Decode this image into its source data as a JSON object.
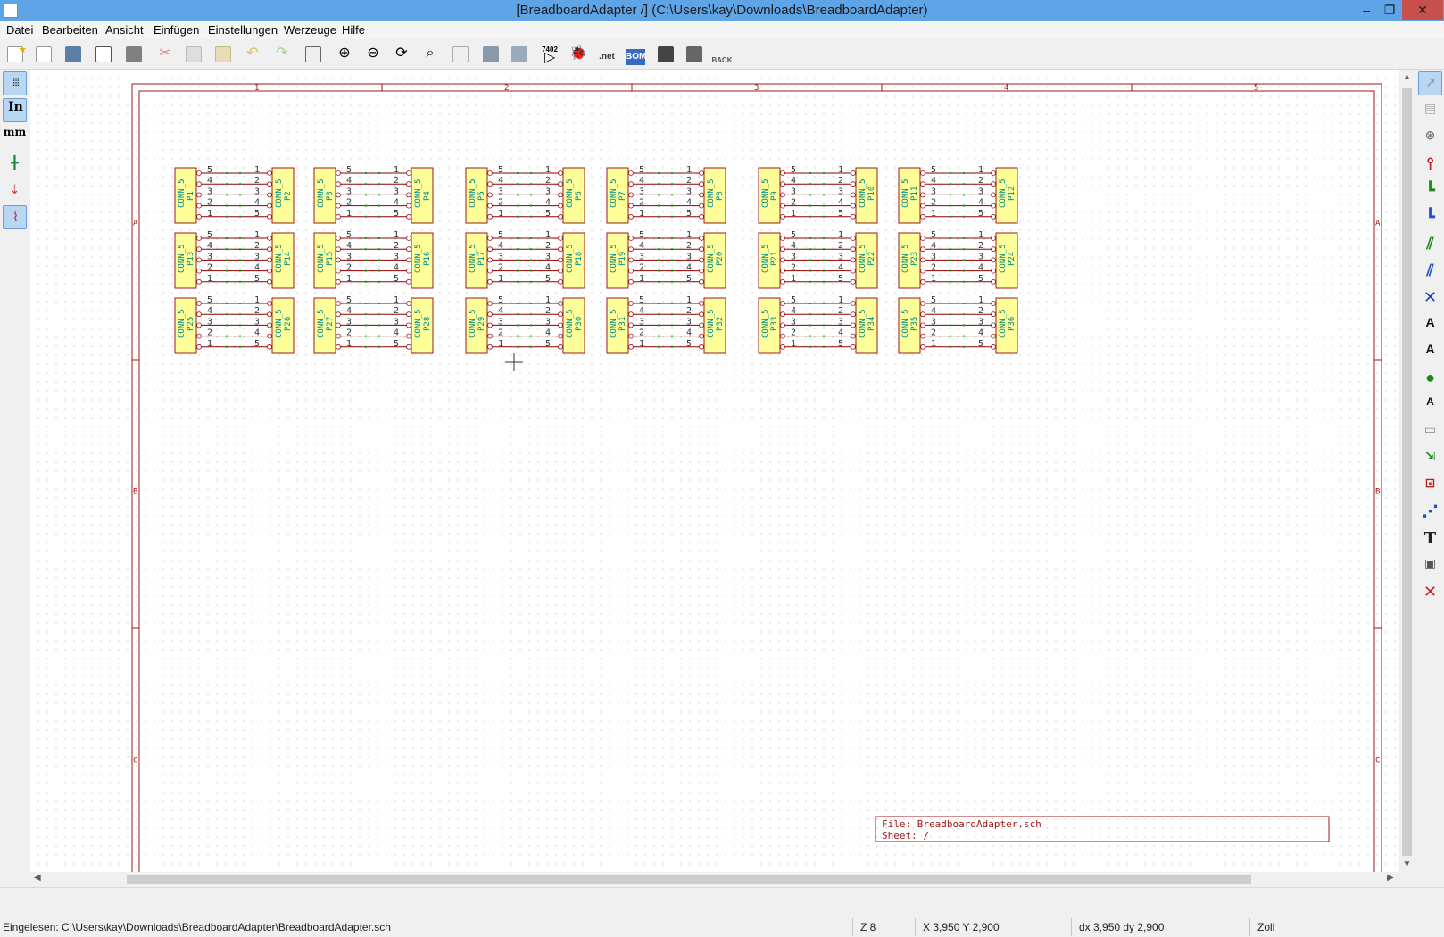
{
  "window": {
    "title": "[BreadboardAdapter /] (C:\\Users\\kay\\Downloads\\BreadboardAdapter)",
    "minimize": "‒",
    "maximize": "❐",
    "close": "✕"
  },
  "menu": [
    "Datei",
    "Bearbeiten",
    "Ansicht",
    "Einfügen",
    "Einstellungen",
    "Werzeuge",
    "Hilfe"
  ],
  "toolbar": {
    "netlist_label": ".net",
    "bom_label": "BOM",
    "back_label": "BACK",
    "part_label": "7402"
  },
  "lefttools": {
    "units_in": "In",
    "units_mm": "mm"
  },
  "sheet": {
    "columns": [
      "1",
      "2",
      "3",
      "4",
      "5"
    ],
    "rows": [
      "A",
      "B",
      "C"
    ],
    "file_label": "File: BreadboardAdapter.sch",
    "sheet_label": "Sheet: /"
  },
  "components": {
    "value": "CONN_5",
    "refs": [
      "P1",
      "P2",
      "P3",
      "P4",
      "P5",
      "P6",
      "P7",
      "P8",
      "P9",
      "P10",
      "P11",
      "P12",
      "P13",
      "P14",
      "P15",
      "P16",
      "P17",
      "P18",
      "P19",
      "P20",
      "P21",
      "P22",
      "P23",
      "P24",
      "P25",
      "P26",
      "P27",
      "P28",
      "P29",
      "P30",
      "P31",
      "P32",
      "P33",
      "P34",
      "P35",
      "P36"
    ],
    "left_pins": [
      "5",
      "4",
      "3",
      "2",
      "1"
    ],
    "right_pins": [
      "1",
      "2",
      "3",
      "4",
      "5"
    ]
  },
  "status": {
    "message": "Eingelesen: C:\\Users\\kay\\Downloads\\BreadboardAdapter\\BreadboardAdapter.sch",
    "zoom": "Z 8",
    "coords": "X 3,950  Y 2,900",
    "delta": "dx 3,950  dy 2,900",
    "units": "Zoll"
  },
  "colors": {
    "frame": "#a01818",
    "component_fill": "#ffff99",
    "text_teal": "#008888",
    "wire": "#8b0000",
    "junction": "#00aa00"
  }
}
